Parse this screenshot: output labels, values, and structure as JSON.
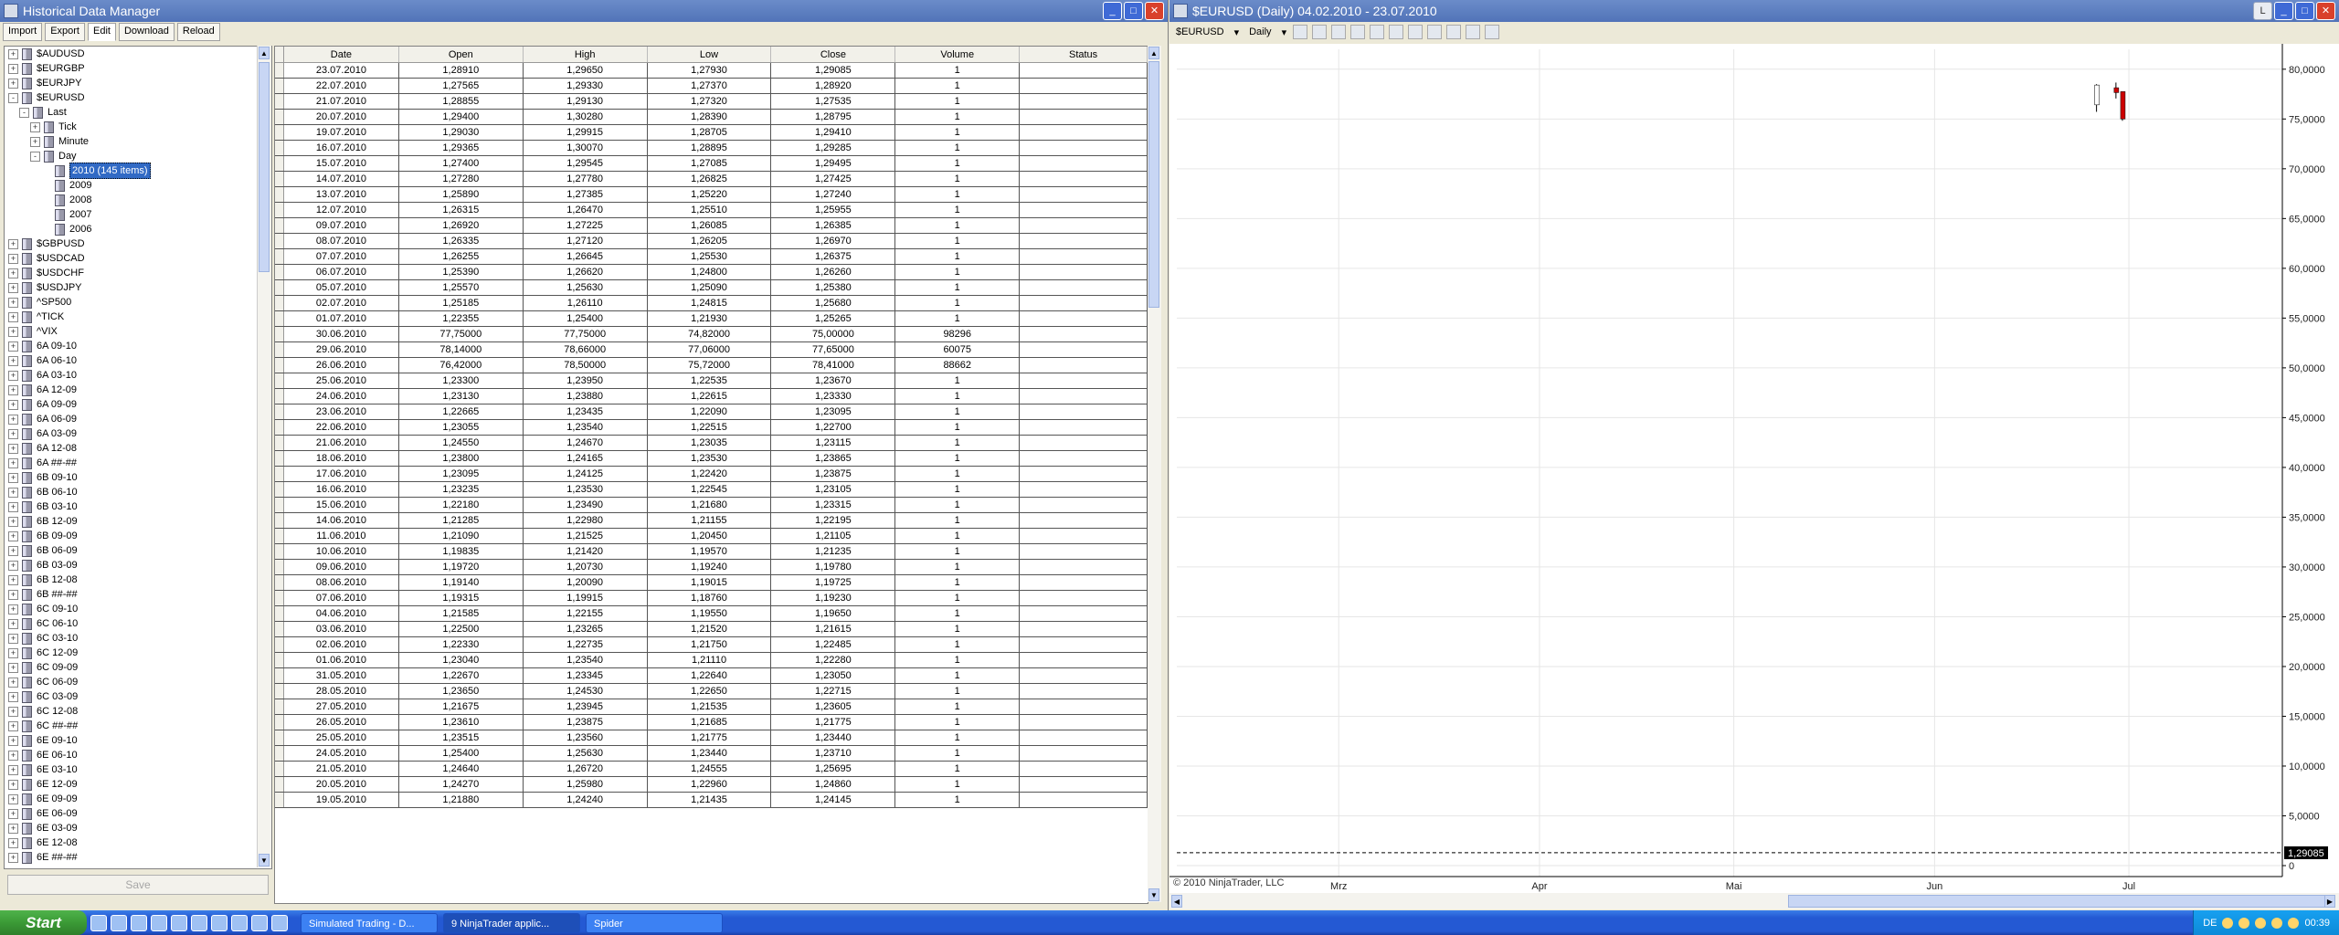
{
  "hdm": {
    "title": "Historical Data Manager",
    "tabs": [
      "Import",
      "Export",
      "Edit",
      "Download",
      "Reload"
    ],
    "active_tab": "Edit",
    "save_label": "Save",
    "tree": [
      {
        "label": "$AUDUSD",
        "level": 0,
        "exp": "+"
      },
      {
        "label": "$EURGBP",
        "level": 0,
        "exp": "+"
      },
      {
        "label": "$EURJPY",
        "level": 0,
        "exp": "+"
      },
      {
        "label": "$EURUSD",
        "level": 0,
        "exp": "-"
      },
      {
        "label": "Last",
        "level": 1,
        "exp": "-"
      },
      {
        "label": "Tick",
        "level": 2,
        "exp": "+"
      },
      {
        "label": "Minute",
        "level": 2,
        "exp": "+"
      },
      {
        "label": "Day",
        "level": 2,
        "exp": "-"
      },
      {
        "label": "2010 (145 items)",
        "level": 3,
        "exp": "",
        "selected": true
      },
      {
        "label": "2009",
        "level": 3,
        "exp": ""
      },
      {
        "label": "2008",
        "level": 3,
        "exp": ""
      },
      {
        "label": "2007",
        "level": 3,
        "exp": ""
      },
      {
        "label": "2006",
        "level": 3,
        "exp": ""
      },
      {
        "label": "$GBPUSD",
        "level": 0,
        "exp": "+"
      },
      {
        "label": "$USDCAD",
        "level": 0,
        "exp": "+"
      },
      {
        "label": "$USDCHF",
        "level": 0,
        "exp": "+"
      },
      {
        "label": "$USDJPY",
        "level": 0,
        "exp": "+"
      },
      {
        "label": "^SP500",
        "level": 0,
        "exp": "+"
      },
      {
        "label": "^TICK",
        "level": 0,
        "exp": "+"
      },
      {
        "label": "^VIX",
        "level": 0,
        "exp": "+"
      },
      {
        "label": "6A 09-10",
        "level": 0,
        "exp": "+"
      },
      {
        "label": "6A 06-10",
        "level": 0,
        "exp": "+"
      },
      {
        "label": "6A 03-10",
        "level": 0,
        "exp": "+"
      },
      {
        "label": "6A 12-09",
        "level": 0,
        "exp": "+"
      },
      {
        "label": "6A 09-09",
        "level": 0,
        "exp": "+"
      },
      {
        "label": "6A 06-09",
        "level": 0,
        "exp": "+"
      },
      {
        "label": "6A 03-09",
        "level": 0,
        "exp": "+"
      },
      {
        "label": "6A 12-08",
        "level": 0,
        "exp": "+"
      },
      {
        "label": "6A ##-##",
        "level": 0,
        "exp": "+"
      },
      {
        "label": "6B 09-10",
        "level": 0,
        "exp": "+"
      },
      {
        "label": "6B 06-10",
        "level": 0,
        "exp": "+"
      },
      {
        "label": "6B 03-10",
        "level": 0,
        "exp": "+"
      },
      {
        "label": "6B 12-09",
        "level": 0,
        "exp": "+"
      },
      {
        "label": "6B 09-09",
        "level": 0,
        "exp": "+"
      },
      {
        "label": "6B 06-09",
        "level": 0,
        "exp": "+"
      },
      {
        "label": "6B 03-09",
        "level": 0,
        "exp": "+"
      },
      {
        "label": "6B 12-08",
        "level": 0,
        "exp": "+"
      },
      {
        "label": "6B ##-##",
        "level": 0,
        "exp": "+"
      },
      {
        "label": "6C 09-10",
        "level": 0,
        "exp": "+"
      },
      {
        "label": "6C 06-10",
        "level": 0,
        "exp": "+"
      },
      {
        "label": "6C 03-10",
        "level": 0,
        "exp": "+"
      },
      {
        "label": "6C 12-09",
        "level": 0,
        "exp": "+"
      },
      {
        "label": "6C 09-09",
        "level": 0,
        "exp": "+"
      },
      {
        "label": "6C 06-09",
        "level": 0,
        "exp": "+"
      },
      {
        "label": "6C 03-09",
        "level": 0,
        "exp": "+"
      },
      {
        "label": "6C 12-08",
        "level": 0,
        "exp": "+"
      },
      {
        "label": "6C ##-##",
        "level": 0,
        "exp": "+"
      },
      {
        "label": "6E 09-10",
        "level": 0,
        "exp": "+"
      },
      {
        "label": "6E 06-10",
        "level": 0,
        "exp": "+"
      },
      {
        "label": "6E 03-10",
        "level": 0,
        "exp": "+"
      },
      {
        "label": "6E 12-09",
        "level": 0,
        "exp": "+"
      },
      {
        "label": "6E 09-09",
        "level": 0,
        "exp": "+"
      },
      {
        "label": "6E 06-09",
        "level": 0,
        "exp": "+"
      },
      {
        "label": "6E 03-09",
        "level": 0,
        "exp": "+"
      },
      {
        "label": "6E 12-08",
        "level": 0,
        "exp": "+"
      },
      {
        "label": "6E ##-##",
        "level": 0,
        "exp": "+"
      }
    ],
    "columns": [
      "Date",
      "Open",
      "High",
      "Low",
      "Close",
      "Volume",
      "Status"
    ],
    "rows": [
      [
        "23.07.2010",
        "1,28910",
        "1,29650",
        "1,27930",
        "1,29085",
        "1",
        ""
      ],
      [
        "22.07.2010",
        "1,27565",
        "1,29330",
        "1,27370",
        "1,28920",
        "1",
        ""
      ],
      [
        "21.07.2010",
        "1,28855",
        "1,29130",
        "1,27320",
        "1,27535",
        "1",
        ""
      ],
      [
        "20.07.2010",
        "1,29400",
        "1,30280",
        "1,28390",
        "1,28795",
        "1",
        ""
      ],
      [
        "19.07.2010",
        "1,29030",
        "1,29915",
        "1,28705",
        "1,29410",
        "1",
        ""
      ],
      [
        "16.07.2010",
        "1,29365",
        "1,30070",
        "1,28895",
        "1,29285",
        "1",
        ""
      ],
      [
        "15.07.2010",
        "1,27400",
        "1,29545",
        "1,27085",
        "1,29495",
        "1",
        ""
      ],
      [
        "14.07.2010",
        "1,27280",
        "1,27780",
        "1,26825",
        "1,27425",
        "1",
        ""
      ],
      [
        "13.07.2010",
        "1,25890",
        "1,27385",
        "1,25220",
        "1,27240",
        "1",
        ""
      ],
      [
        "12.07.2010",
        "1,26315",
        "1,26470",
        "1,25510",
        "1,25955",
        "1",
        ""
      ],
      [
        "09.07.2010",
        "1,26920",
        "1,27225",
        "1,26085",
        "1,26385",
        "1",
        ""
      ],
      [
        "08.07.2010",
        "1,26335",
        "1,27120",
        "1,26205",
        "1,26970",
        "1",
        ""
      ],
      [
        "07.07.2010",
        "1,26255",
        "1,26645",
        "1,25530",
        "1,26375",
        "1",
        ""
      ],
      [
        "06.07.2010",
        "1,25390",
        "1,26620",
        "1,24800",
        "1,26260",
        "1",
        ""
      ],
      [
        "05.07.2010",
        "1,25570",
        "1,25630",
        "1,25090",
        "1,25380",
        "1",
        ""
      ],
      [
        "02.07.2010",
        "1,25185",
        "1,26110",
        "1,24815",
        "1,25680",
        "1",
        ""
      ],
      [
        "01.07.2010",
        "1,22355",
        "1,25400",
        "1,21930",
        "1,25265",
        "1",
        ""
      ],
      [
        "30.06.2010",
        "77,75000",
        "77,75000",
        "74,82000",
        "75,00000",
        "98296",
        ""
      ],
      [
        "29.06.2010",
        "78,14000",
        "78,66000",
        "77,06000",
        "77,65000",
        "60075",
        ""
      ],
      [
        "26.06.2010",
        "76,42000",
        "78,50000",
        "75,72000",
        "78,41000",
        "88662",
        ""
      ],
      [
        "25.06.2010",
        "1,23300",
        "1,23950",
        "1,22535",
        "1,23670",
        "1",
        ""
      ],
      [
        "24.06.2010",
        "1,23130",
        "1,23880",
        "1,22615",
        "1,23330",
        "1",
        ""
      ],
      [
        "23.06.2010",
        "1,22665",
        "1,23435",
        "1,22090",
        "1,23095",
        "1",
        ""
      ],
      [
        "22.06.2010",
        "1,23055",
        "1,23540",
        "1,22515",
        "1,22700",
        "1",
        ""
      ],
      [
        "21.06.2010",
        "1,24550",
        "1,24670",
        "1,23035",
        "1,23115",
        "1",
        ""
      ],
      [
        "18.06.2010",
        "1,23800",
        "1,24165",
        "1,23530",
        "1,23865",
        "1",
        ""
      ],
      [
        "17.06.2010",
        "1,23095",
        "1,24125",
        "1,22420",
        "1,23875",
        "1",
        ""
      ],
      [
        "16.06.2010",
        "1,23235",
        "1,23530",
        "1,22545",
        "1,23105",
        "1",
        ""
      ],
      [
        "15.06.2010",
        "1,22180",
        "1,23490",
        "1,21680",
        "1,23315",
        "1",
        ""
      ],
      [
        "14.06.2010",
        "1,21285",
        "1,22980",
        "1,21155",
        "1,22195",
        "1",
        ""
      ],
      [
        "11.06.2010",
        "1,21090",
        "1,21525",
        "1,20450",
        "1,21105",
        "1",
        ""
      ],
      [
        "10.06.2010",
        "1,19835",
        "1,21420",
        "1,19570",
        "1,21235",
        "1",
        ""
      ],
      [
        "09.06.2010",
        "1,19720",
        "1,20730",
        "1,19240",
        "1,19780",
        "1",
        ""
      ],
      [
        "08.06.2010",
        "1,19140",
        "1,20090",
        "1,19015",
        "1,19725",
        "1",
        ""
      ],
      [
        "07.06.2010",
        "1,19315",
        "1,19915",
        "1,18760",
        "1,19230",
        "1",
        ""
      ],
      [
        "04.06.2010",
        "1,21585",
        "1,22155",
        "1,19550",
        "1,19650",
        "1",
        ""
      ],
      [
        "03.06.2010",
        "1,22500",
        "1,23265",
        "1,21520",
        "1,21615",
        "1",
        ""
      ],
      [
        "02.06.2010",
        "1,22330",
        "1,22735",
        "1,21750",
        "1,22485",
        "1",
        ""
      ],
      [
        "01.06.2010",
        "1,23040",
        "1,23540",
        "1,21110",
        "1,22280",
        "1",
        ""
      ],
      [
        "31.05.2010",
        "1,22670",
        "1,23345",
        "1,22640",
        "1,23050",
        "1",
        ""
      ],
      [
        "28.05.2010",
        "1,23650",
        "1,24530",
        "1,22650",
        "1,22715",
        "1",
        ""
      ],
      [
        "27.05.2010",
        "1,21675",
        "1,23945",
        "1,21535",
        "1,23605",
        "1",
        ""
      ],
      [
        "26.05.2010",
        "1,23610",
        "1,23875",
        "1,21685",
        "1,21775",
        "1",
        ""
      ],
      [
        "25.05.2010",
        "1,23515",
        "1,23560",
        "1,21775",
        "1,23440",
        "1",
        ""
      ],
      [
        "24.05.2010",
        "1,25400",
        "1,25630",
        "1,23440",
        "1,23710",
        "1",
        ""
      ],
      [
        "21.05.2010",
        "1,24640",
        "1,26720",
        "1,24555",
        "1,25695",
        "1",
        ""
      ],
      [
        "20.05.2010",
        "1,24270",
        "1,25980",
        "1,22960",
        "1,24860",
        "1",
        ""
      ],
      [
        "19.05.2010",
        "1,21880",
        "1,24240",
        "1,21435",
        "1,24145",
        "1",
        ""
      ]
    ]
  },
  "chart_window": {
    "title": "$EURUSD (Daily)  04.02.2010 - 23.07.2010",
    "instrument": "$EURUSD",
    "interval": "Daily",
    "copyright": "© 2010 NinjaTrader, LLC",
    "price_marker": "1,29085"
  },
  "chart_data": {
    "type": "candlestick",
    "x_ticks": [
      "Mrz",
      "Apr",
      "Mai",
      "Jun",
      "Jul"
    ],
    "y_ticks": [
      "0",
      "5,0000",
      "10,0000",
      "15,0000",
      "20,0000",
      "25,0000",
      "30,0000",
      "35,0000",
      "40,0000",
      "45,0000",
      "50,0000",
      "55,0000",
      "60,0000",
      "65,0000",
      "70,0000",
      "75,0000",
      "80,0000"
    ],
    "y_tick_values": [
      0,
      5,
      10,
      15,
      20,
      25,
      30,
      35,
      40,
      45,
      50,
      55,
      60,
      65,
      70,
      75,
      80
    ],
    "ylim": [
      0,
      82
    ],
    "x_tick_dates": [
      "2010-03-01",
      "2010-04-01",
      "2010-05-01",
      "2010-06-01",
      "2010-07-01"
    ],
    "xlim": [
      "2010-02-04",
      "2010-07-23"
    ],
    "candles": [
      {
        "date": "2010-06-26",
        "open": 76.42,
        "high": 78.5,
        "low": 75.72,
        "close": 78.41
      },
      {
        "date": "2010-06-29",
        "open": 78.14,
        "high": 78.66,
        "low": 77.06,
        "close": 77.65
      },
      {
        "date": "2010-06-30",
        "open": 77.75,
        "high": 77.75,
        "low": 74.82,
        "close": 75.0
      }
    ],
    "baseline_value": 1.29085,
    "up_color": "#ffffff",
    "down_color": "#cc0000"
  },
  "taskbar": {
    "start_label": "Start",
    "tasks": [
      "Simulated Trading - D...",
      "9 NinjaTrader applic...",
      "Spider"
    ],
    "active_task": 1,
    "lang": "DE",
    "clock": "00:39"
  },
  "colors": {
    "titlebar": "#5173b8",
    "taskbar": "#2459d3",
    "selection": "#316ac5"
  }
}
